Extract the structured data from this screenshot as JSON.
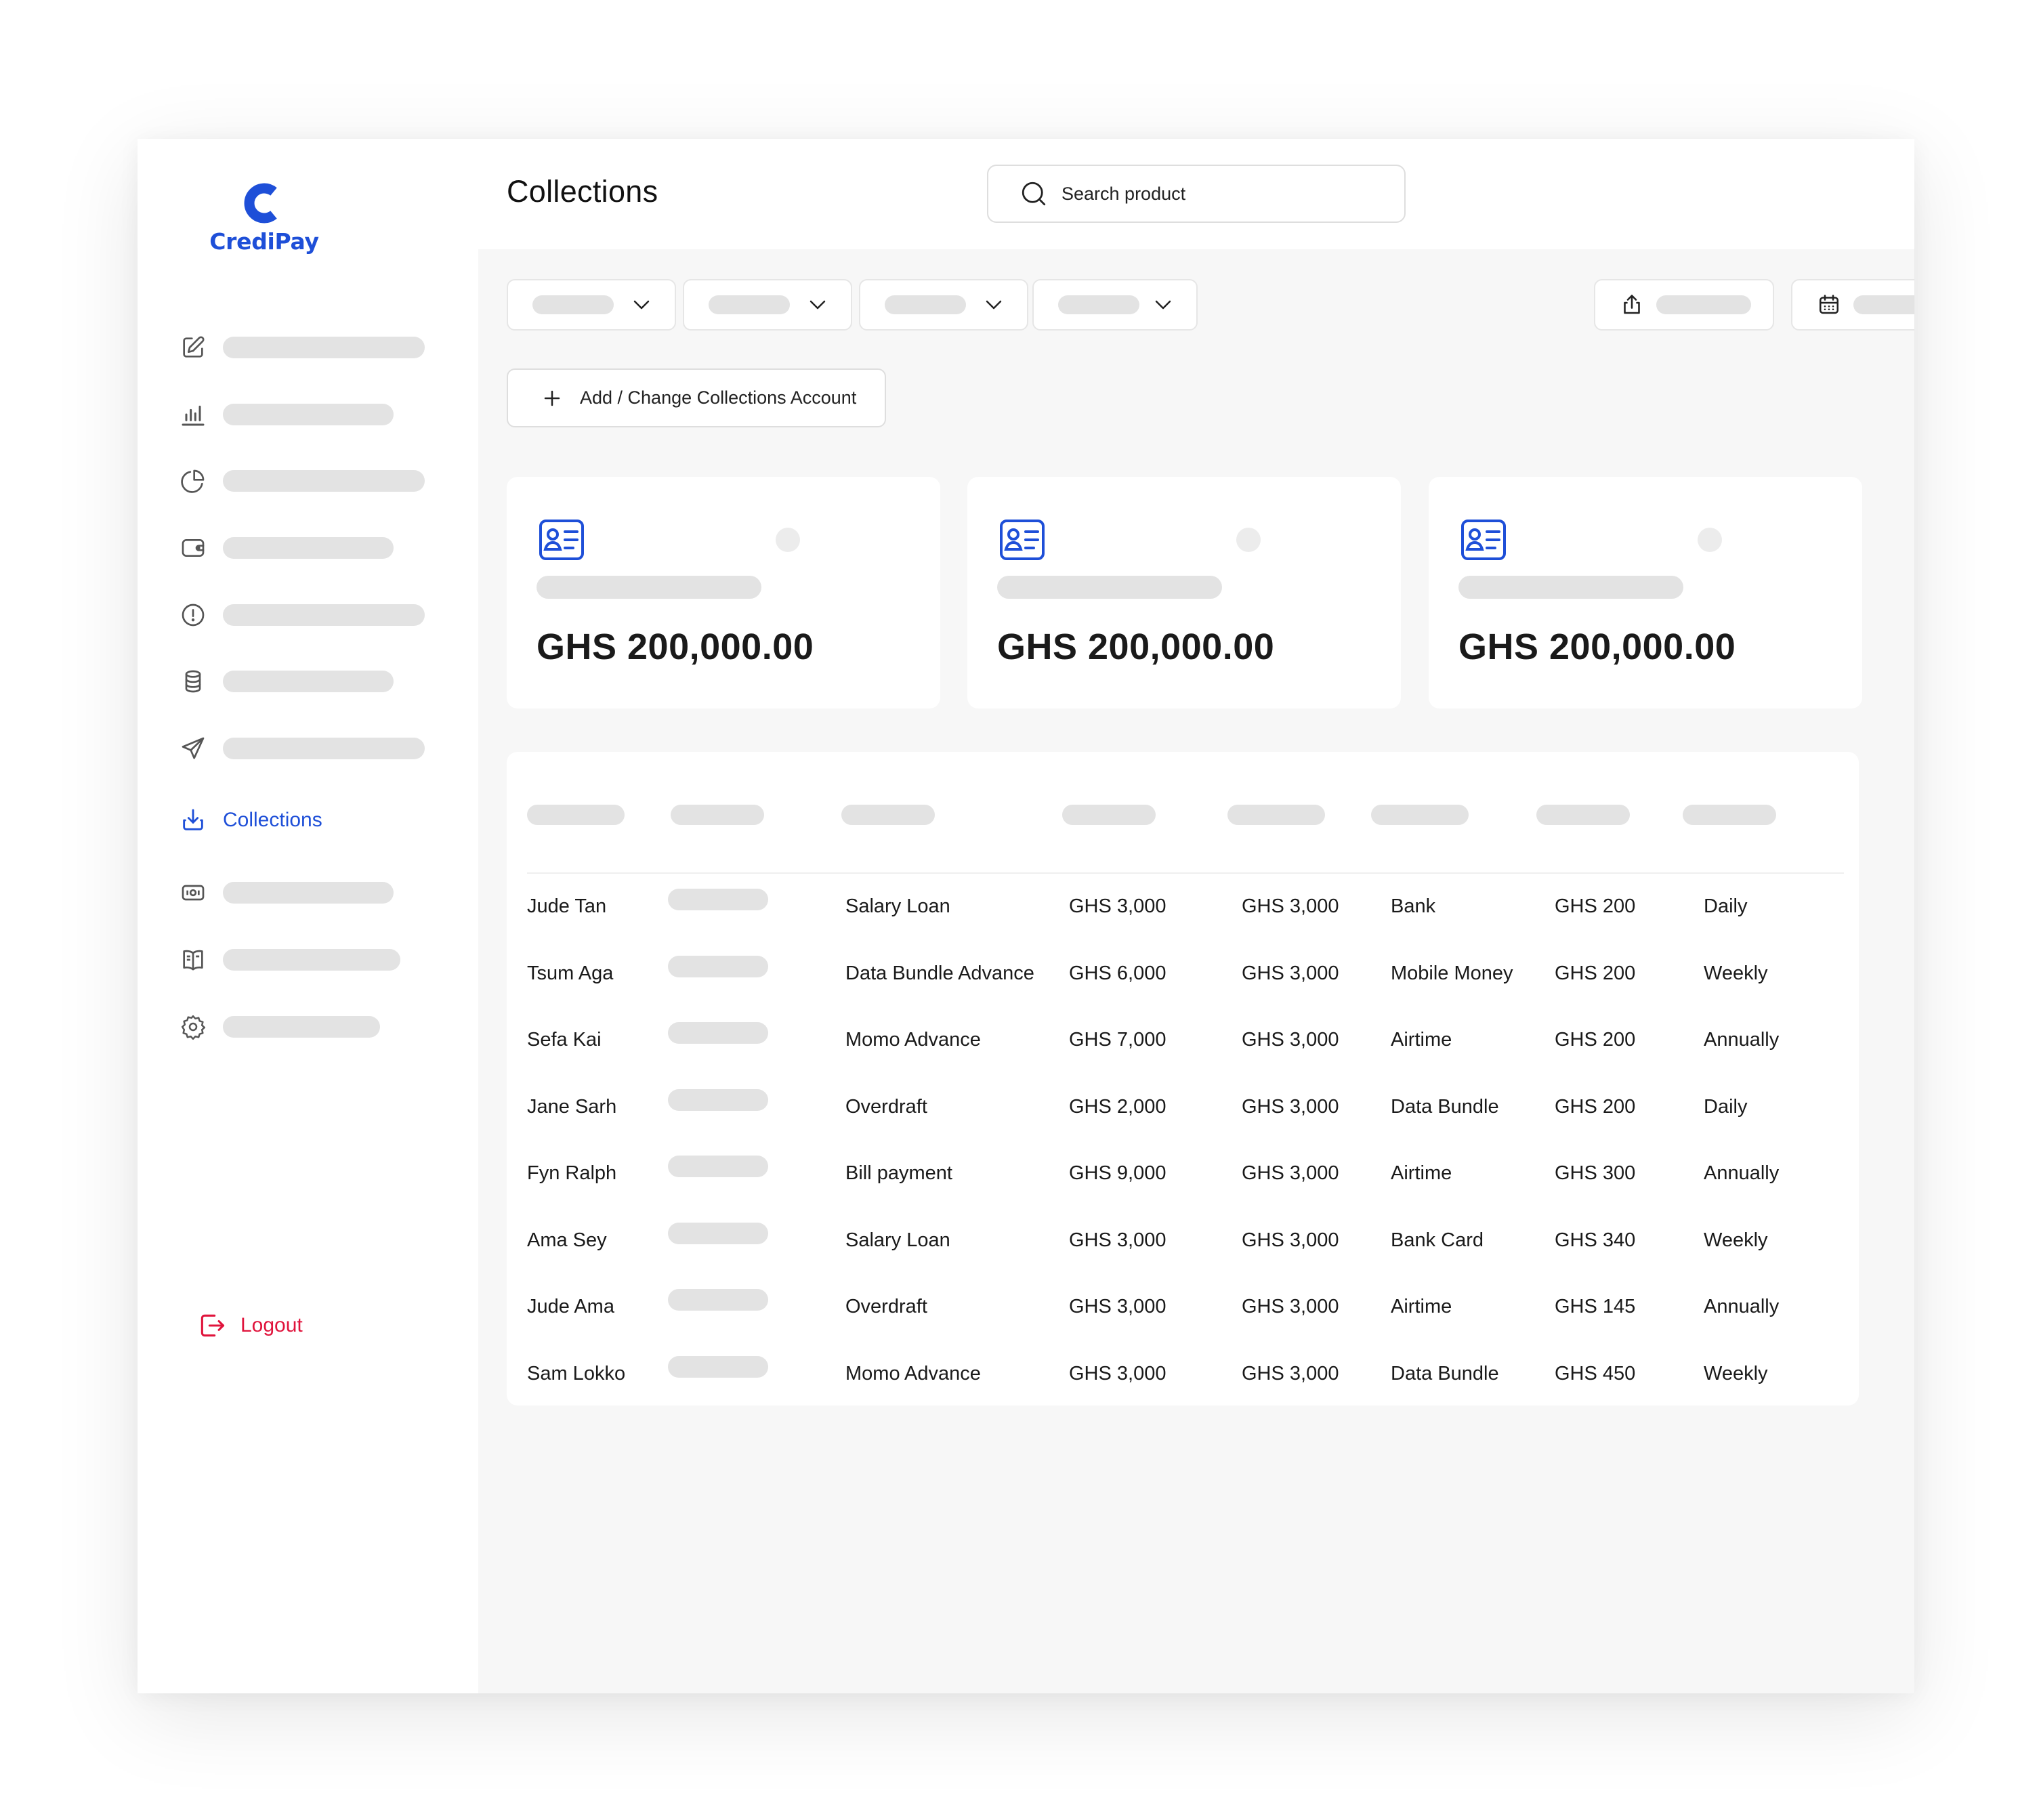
{
  "app": {
    "name": "CrediPay",
    "brand_color": "#1e4fd8",
    "danger_color": "#e0143c"
  },
  "sidebar": {
    "items": [
      {
        "icon": "edit-icon"
      },
      {
        "icon": "bar-chart-icon"
      },
      {
        "icon": "pie-chart-icon"
      },
      {
        "icon": "wallet-icon"
      },
      {
        "icon": "alert-circle-icon"
      },
      {
        "icon": "database-icon"
      },
      {
        "icon": "send-icon"
      },
      {
        "icon": "download-icon",
        "label": "Collections",
        "active": true
      },
      {
        "icon": "cash-icon"
      },
      {
        "icon": "book-icon"
      },
      {
        "icon": "gear-icon"
      }
    ],
    "logout_label": "Logout"
  },
  "header": {
    "title": "Collections",
    "search_placeholder": "Search product"
  },
  "actions": {
    "add_account_label": "Add / Change Collections Account"
  },
  "cards": [
    {
      "amount": "GHS 200,000.00"
    },
    {
      "amount": "GHS 200,000.00"
    },
    {
      "amount": "GHS 200,000.00"
    }
  ],
  "table": {
    "rows": [
      {
        "name": "Jude Tan",
        "product": "Salary Loan",
        "amount": "GHS 3,000",
        "amount2": "GHS 3,000",
        "channel": "Bank",
        "fee": "GHS 200",
        "frequency": "Daily"
      },
      {
        "name": "Tsum Aga",
        "product": "Data Bundle Advance",
        "amount": "GHS 6,000",
        "amount2": "GHS 3,000",
        "channel": "Mobile Money",
        "fee": "GHS 200",
        "frequency": "Weekly"
      },
      {
        "name": "Sefa Kai",
        "product": "Momo Advance",
        "amount": "GHS 7,000",
        "amount2": "GHS 3,000",
        "channel": "Airtime",
        "fee": "GHS 200",
        "frequency": "Annually"
      },
      {
        "name": "Jane Sarh",
        "product": "Overdraft",
        "amount": "GHS 2,000",
        "amount2": "GHS 3,000",
        "channel": "Data Bundle",
        "fee": "GHS 200",
        "frequency": "Daily"
      },
      {
        "name": "Fyn Ralph",
        "product": "Bill payment",
        "amount": "GHS 9,000",
        "amount2": "GHS 3,000",
        "channel": "Airtime",
        "fee": "GHS 300",
        "frequency": "Annually"
      },
      {
        "name": "Ama Sey",
        "product": "Salary Loan",
        "amount": "GHS 3,000",
        "amount2": "GHS 3,000",
        "channel": "Bank Card",
        "fee": "GHS 340",
        "frequency": "Weekly"
      },
      {
        "name": "Jude Ama",
        "product": "Overdraft",
        "amount": "GHS 3,000",
        "amount2": "GHS 3,000",
        "channel": "Airtime",
        "fee": "GHS 145",
        "frequency": "Annually"
      },
      {
        "name": "Sam Lokko",
        "product": "Momo Advance",
        "amount": "GHS 3,000",
        "amount2": "GHS 3,000",
        "channel": "Data Bundle",
        "fee": "GHS 450",
        "frequency": "Weekly"
      }
    ]
  }
}
